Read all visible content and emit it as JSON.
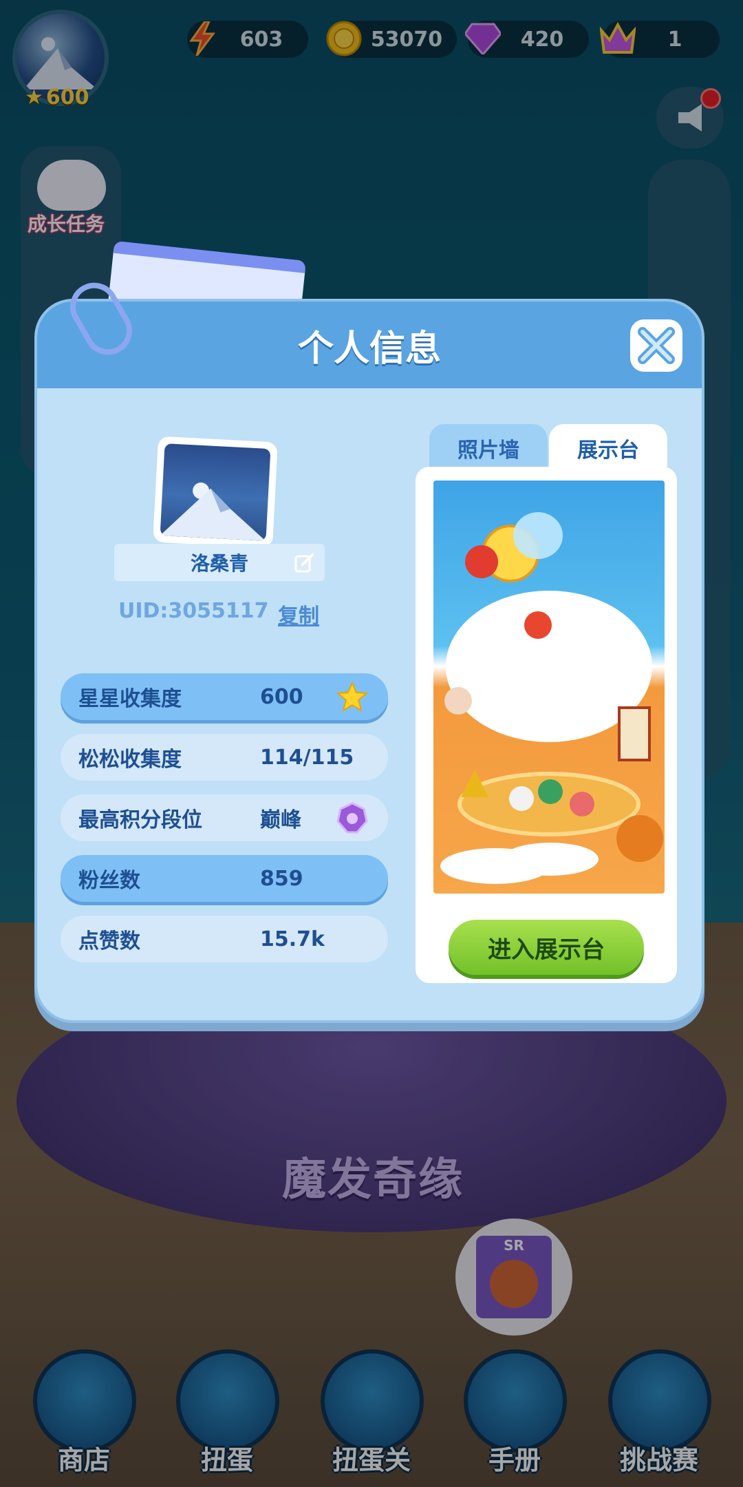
{
  "top_bar": {
    "star_count": "600",
    "resources": [
      {
        "name": "energy",
        "icon": "lightning-icon",
        "value": "603"
      },
      {
        "name": "coins",
        "icon": "coin-icon",
        "value": "53070"
      },
      {
        "name": "gems",
        "icon": "gem-icon",
        "value": "420"
      },
      {
        "name": "crown",
        "icon": "crown-icon",
        "value": "1"
      }
    ]
  },
  "side": {
    "growth_task_label": "成长任务"
  },
  "modal": {
    "title": "个人信息",
    "profile": {
      "name": "洛桑青",
      "uid": "UID:3055117",
      "copy_label": "复制"
    },
    "stats": [
      {
        "label": "星星收集度",
        "value": "600",
        "icon": "star-icon",
        "highlight": true
      },
      {
        "label": "松松收集度",
        "value": "114/115",
        "icon": "",
        "highlight": false
      },
      {
        "label": "最高积分段位",
        "value": "巅峰",
        "icon": "rank-badge-icon",
        "highlight": false
      },
      {
        "label": "粉丝数",
        "value": "859",
        "icon": "",
        "highlight": true
      },
      {
        "label": "点赞数",
        "value": "15.7k",
        "icon": "",
        "highlight": false
      }
    ],
    "tabs": [
      {
        "label": "照片墙",
        "active": false
      },
      {
        "label": "展示台",
        "active": true
      }
    ],
    "enter_button": "进入展示台"
  },
  "stage": {
    "title": "魔发奇缘",
    "bubble_rarity": "SR"
  },
  "bottom_nav": [
    {
      "label": "商店",
      "icon": "shop-icon"
    },
    {
      "label": "扭蛋",
      "icon": "gacha-icon"
    },
    {
      "label": "扭蛋关",
      "icon": "gacha-level-icon"
    },
    {
      "label": "手册",
      "icon": "handbook-icon"
    },
    {
      "label": "挑战赛",
      "icon": "challenge-icon"
    }
  ],
  "colors": {
    "modal_bg": "#bfe0f7",
    "modal_header": "#5ba4e2",
    "text_blue": "#1e4f91",
    "enter_green": "#72c128"
  }
}
